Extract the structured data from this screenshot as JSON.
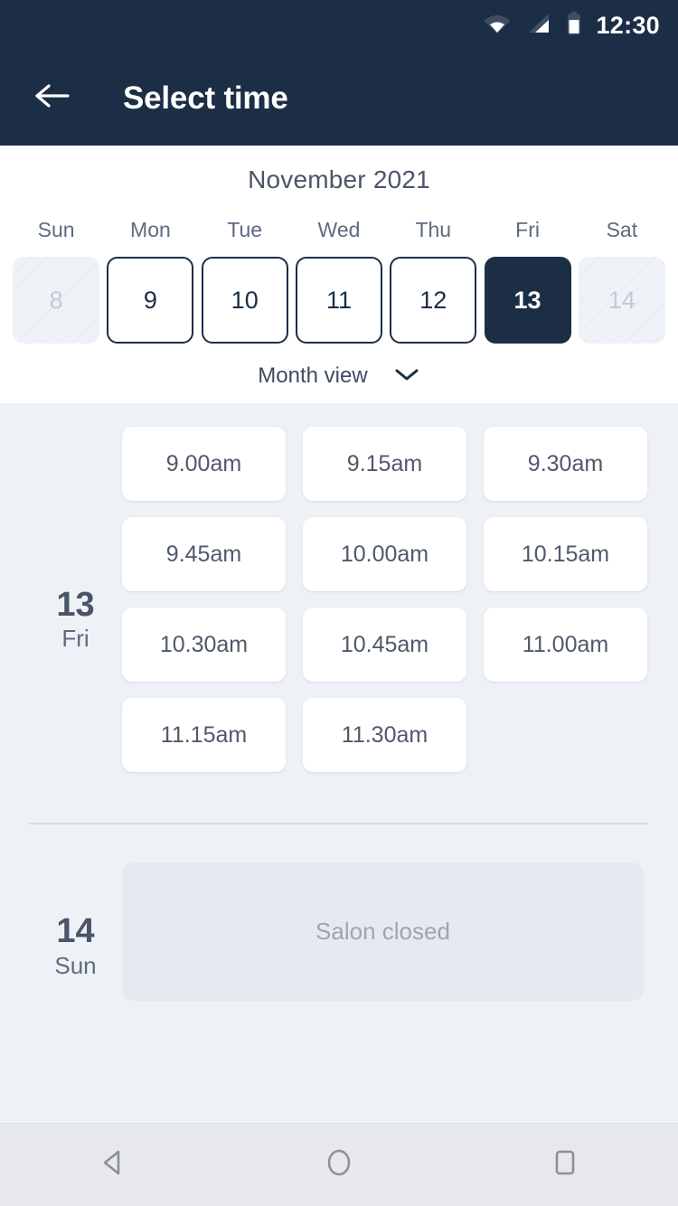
{
  "status_bar": {
    "time": "12:30",
    "icons": [
      "wifi-icon",
      "signal-icon",
      "battery-icon"
    ]
  },
  "app_bar": {
    "back_icon": "back-arrow-icon",
    "title": "Select time"
  },
  "calendar": {
    "month_title": "November 2021",
    "weekdays": [
      "Sun",
      "Mon",
      "Tue",
      "Wed",
      "Thu",
      "Fri",
      "Sat"
    ],
    "days": [
      {
        "num": "8",
        "state": "disabled"
      },
      {
        "num": "9",
        "state": "available"
      },
      {
        "num": "10",
        "state": "available"
      },
      {
        "num": "11",
        "state": "available"
      },
      {
        "num": "12",
        "state": "available"
      },
      {
        "num": "13",
        "state": "selected"
      },
      {
        "num": "14",
        "state": "disabled"
      }
    ],
    "month_view_label": "Month view",
    "month_view_icon": "chevron-down-icon"
  },
  "schedule": [
    {
      "day_number": "13",
      "day_name": "Fri",
      "slots": [
        "9.00am",
        "9.15am",
        "9.30am",
        "9.45am",
        "10.00am",
        "10.15am",
        "10.30am",
        "10.45am",
        "11.00am",
        "11.15am",
        "11.30am"
      ]
    },
    {
      "day_number": "14",
      "day_name": "Sun",
      "closed_message": "Salon closed"
    }
  ],
  "nav_bar": {
    "back": "nav-back-icon",
    "home": "nav-home-icon",
    "recents": "nav-recents-icon"
  },
  "colors": {
    "header_bg": "#1b2e45",
    "page_bg": "#eef1f6",
    "panel_bg": "#ffffff",
    "accent": "#1b2e45",
    "text_primary": "#4a5568",
    "text_muted": "#9aa5b8",
    "nav_bg": "#e6e8eb"
  }
}
